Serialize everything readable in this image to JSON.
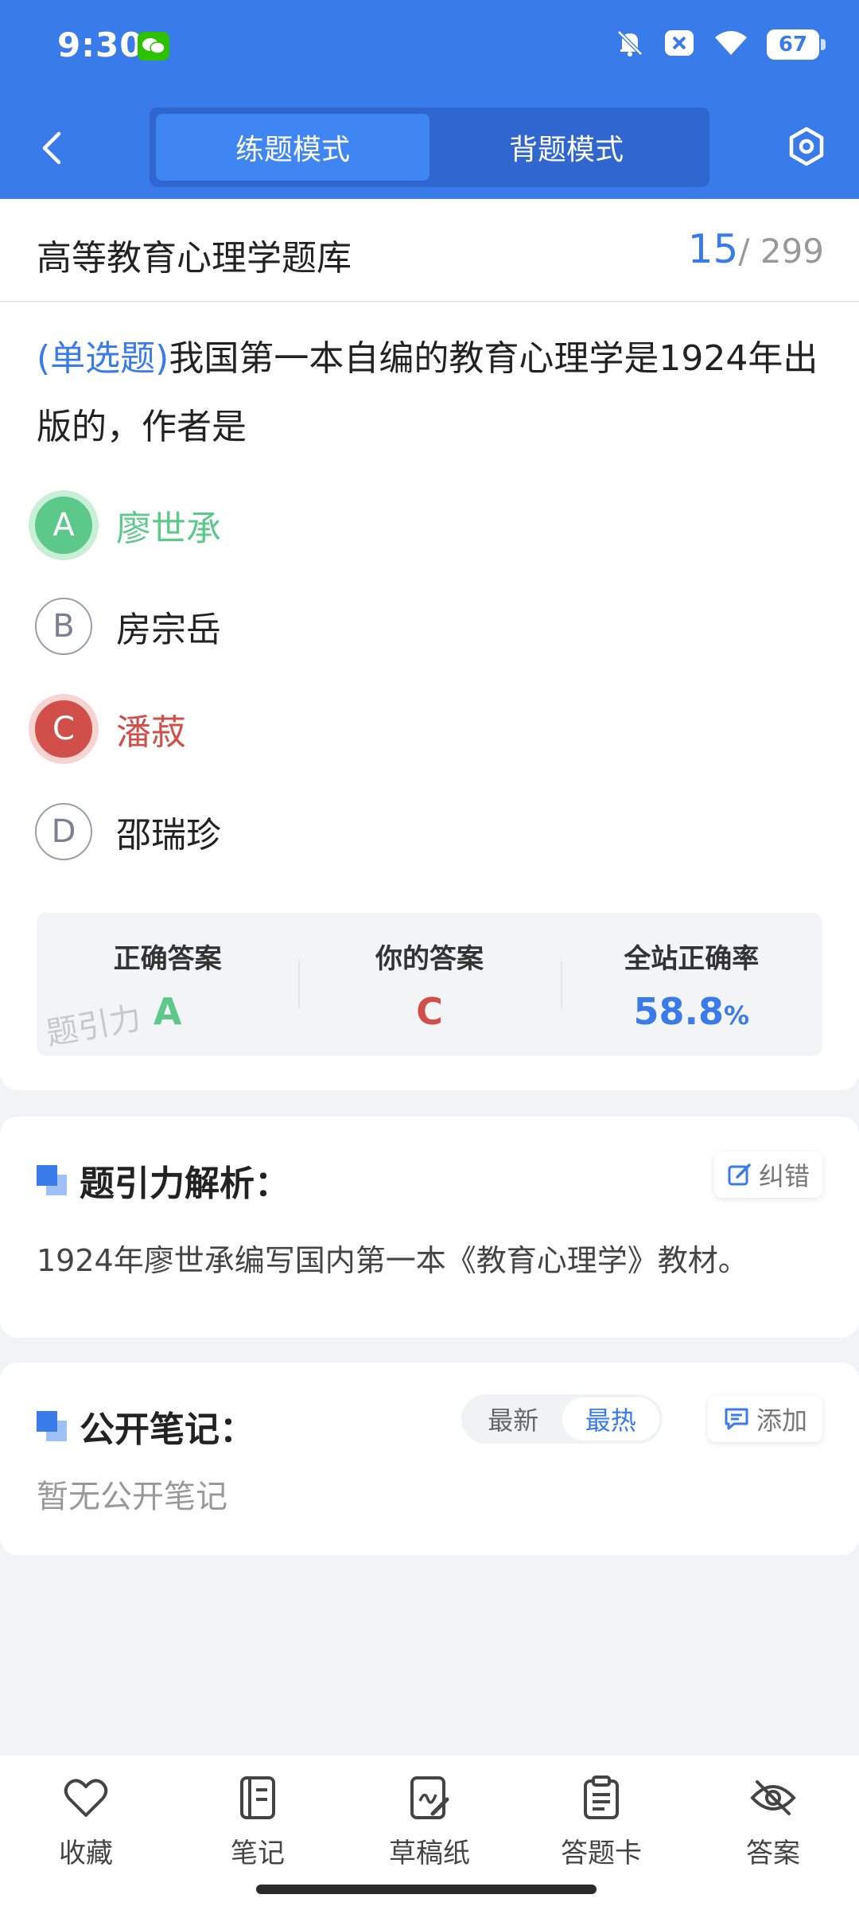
{
  "status_bar": {
    "time": "9:30",
    "battery": "67",
    "icons": [
      "wechat-icon",
      "bell-off-icon",
      "close-badge-icon",
      "wifi-icon",
      "battery-icon"
    ]
  },
  "header": {
    "back_icon": "chevron-left-icon",
    "mode_tabs": [
      {
        "label": "练题模式",
        "active": true
      },
      {
        "label": "背题模式",
        "active": false
      }
    ],
    "settings_icon": "settings-hex-icon"
  },
  "question_bank": {
    "title": "高等教育心理学题库",
    "current": "15",
    "total": "/ 299"
  },
  "question": {
    "type": "(单选题)",
    "text": "我国第一本自编的教育心理学是1924年出版的，作者是",
    "options": [
      {
        "letter": "A",
        "text": "廖世承",
        "state": "correct"
      },
      {
        "letter": "B",
        "text": "房宗岳",
        "state": "normal"
      },
      {
        "letter": "C",
        "text": "潘菽",
        "state": "wrong"
      },
      {
        "letter": "D",
        "text": "邵瑞珍",
        "state": "normal"
      }
    ]
  },
  "result": {
    "correct_label": "正确答案",
    "correct_value": "A",
    "yours_label": "你的答案",
    "yours_value": "C",
    "rate_label": "全站正确率",
    "rate_value": "58.8",
    "rate_unit": "%",
    "watermark": "题引力"
  },
  "analysis": {
    "title": "题引力解析：",
    "report_label": "纠错",
    "text": "1924年廖世承编写国内第一本《教育心理学》教材。"
  },
  "notes": {
    "title": "公开笔记：",
    "sort_options": [
      {
        "label": "最新",
        "active": false
      },
      {
        "label": "最热",
        "active": true
      }
    ],
    "add_label": "添加",
    "empty_text": "暂无公开笔记"
  },
  "bottom_nav": [
    {
      "label": "收藏",
      "icon": "heart-icon"
    },
    {
      "label": "笔记",
      "icon": "notebook-icon"
    },
    {
      "label": "草稿纸",
      "icon": "draft-paper-icon"
    },
    {
      "label": "答题卡",
      "icon": "answer-sheet-icon"
    },
    {
      "label": "答案",
      "icon": "eye-off-icon"
    }
  ],
  "colors": {
    "primary": "#3a7bea",
    "correct": "#5cc98b",
    "wrong": "#d14f4a"
  }
}
